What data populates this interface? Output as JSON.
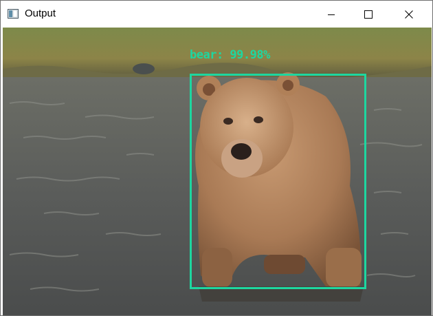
{
  "window": {
    "title": "Output"
  },
  "detection": {
    "label": "bear: 99.98%",
    "color": "#1dd7a0"
  },
  "icons": {
    "app": "window-app-icon",
    "minimize": "minimize-icon",
    "maximize": "maximize-icon",
    "close": "close-icon"
  }
}
